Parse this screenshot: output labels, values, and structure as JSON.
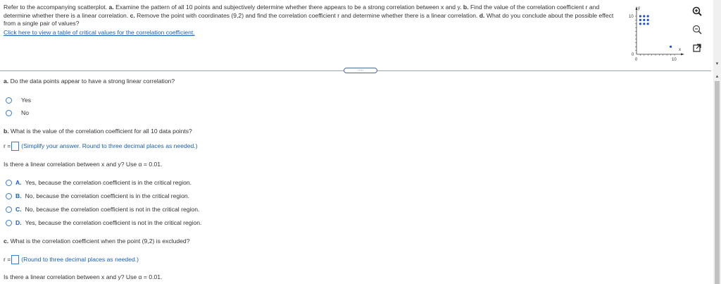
{
  "prompt": {
    "lead": "Refer to the accompanying scatterplot.",
    "a_label": "a.",
    "a_text": "Examine the pattern of all 10 points and subjectively determine whether there appears to be a strong correlation between x and y.",
    "b_label": "b.",
    "b_text": "Find the value of the correlation coefficient r and determine whether there is a linear correlation.",
    "c_label": "c.",
    "c_text": "Remove the point with coordinates (9,2) and find the correlation coefficient r and determine whether there is a linear correlation.",
    "d_label": "d.",
    "d_text": "What do you conclude about the possible effect from a single pair of values?",
    "link_text": "Click here to view a table of critical values for the correlation coefficient."
  },
  "mini_plot": {
    "y_axis_label": "y",
    "x_axis_label": "x",
    "y_tick_top": "10",
    "y_tick_bottom": "0",
    "x_tick_left": "0",
    "x_tick_right": "10"
  },
  "chart_data": {
    "type": "scatter",
    "xlabel": "x",
    "ylabel": "y",
    "xlim": [
      0,
      10
    ],
    "ylim": [
      0,
      10
    ],
    "points": [
      {
        "x": 1,
        "y": 8
      },
      {
        "x": 2,
        "y": 8
      },
      {
        "x": 3,
        "y": 8
      },
      {
        "x": 1,
        "y": 9
      },
      {
        "x": 2,
        "y": 9
      },
      {
        "x": 3,
        "y": 9
      },
      {
        "x": 1,
        "y": 10
      },
      {
        "x": 2,
        "y": 10
      },
      {
        "x": 3,
        "y": 10
      },
      {
        "x": 9,
        "y": 2
      }
    ],
    "color": "#1e4fc2"
  },
  "tools": {
    "zoom_in": "zoom-in-icon",
    "zoom_out": "zoom-out-icon",
    "popout": "popout-icon"
  },
  "divider_handle": ".....",
  "part_a": {
    "label": "a.",
    "question": "Do the data points appear to have a strong linear correlation?",
    "options": [
      "Yes",
      "No"
    ]
  },
  "part_b": {
    "label": "b.",
    "question": "What is the value of the correlation coefficient for all 10 data points?",
    "r_prefix": "r =",
    "hint": "(Simplify your answer. Round to three decimal places as needed.)",
    "linear_question": "Is there a linear correlation between x and y? Use α = 0.01.",
    "choices": [
      {
        "letter": "A.",
        "text": "Yes, because the correlation coefficient is in the critical region."
      },
      {
        "letter": "B.",
        "text": "No, because the correlation coefficient is in the critical region."
      },
      {
        "letter": "C.",
        "text": "No, because the correlation coefficient is not in the critical region."
      },
      {
        "letter": "D.",
        "text": "Yes, because the correlation coefficient is not in the critical region."
      }
    ]
  },
  "part_c": {
    "label": "c.",
    "question": "What is the correlation coefficient when the point (9,2) is excluded?",
    "r_prefix": "r =",
    "hint": "(Round to three decimal places as needed.)",
    "linear_question": "Is there a linear correlation between x and y? Use α = 0.01."
  },
  "scrollbar": {
    "up": "▲",
    "down": "▼"
  },
  "colors": {
    "accent": "#1a5fb4",
    "radio": "#3a7bc8",
    "point": "#1e4fc2"
  }
}
